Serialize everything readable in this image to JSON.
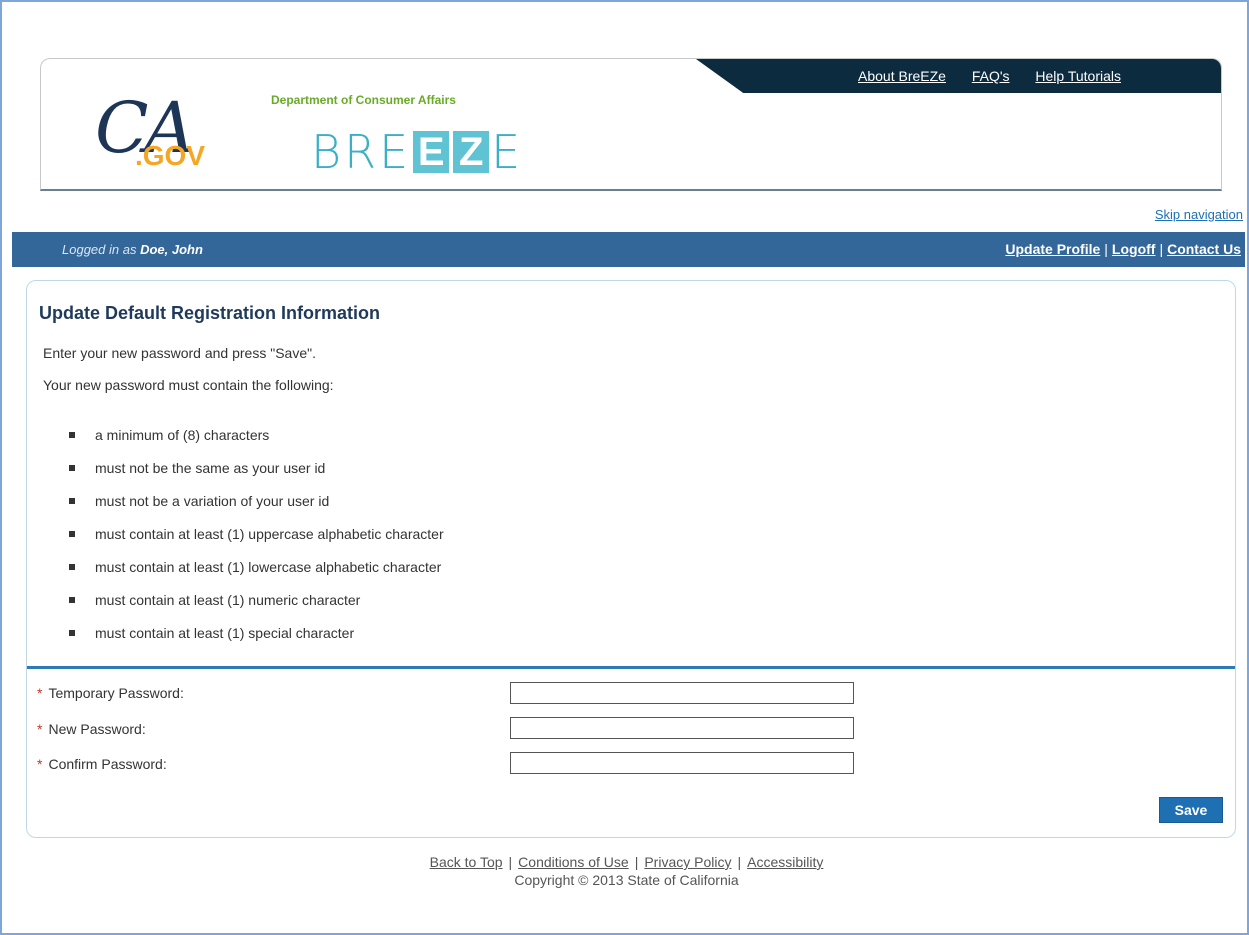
{
  "header": {
    "top_links": [
      "About BreEZe",
      "FAQ's",
      "Help Tutorials"
    ],
    "ca_logo": {
      "text_main": "CA",
      "text_suffix": ".GOV"
    },
    "dca_text": "Department of Consumer Affairs",
    "breeze_logo": {
      "pre": "BRE",
      "box1": "E",
      "box2": "Z",
      "post": "E"
    }
  },
  "skip_navigation": "Skip navigation",
  "userbar": {
    "logged_in_prefix": "Logged in as",
    "user_name": "Doe, John",
    "links": [
      "Update Profile",
      "Logoff",
      "Contact Us"
    ],
    "separator": "|"
  },
  "main": {
    "title": "Update Default Registration Information",
    "intro1": "Enter your new password and press \"Save\".",
    "intro2": "Your new password must contain the following:",
    "rules": [
      "a minimum of (8) characters",
      "must not be the same as your user id",
      "must not be a variation of your user id",
      "must contain at least (1) uppercase alphabetic character",
      "must contain at least (1) lowercase alphabetic character",
      "must contain at least (1) numeric character",
      "must contain at least (1) special character"
    ],
    "form": {
      "required_marker": "*",
      "fields": [
        {
          "label": "Temporary Password:",
          "value": ""
        },
        {
          "label": "New Password:",
          "value": ""
        },
        {
          "label": "Confirm Password:",
          "value": ""
        }
      ],
      "save_label": "Save"
    }
  },
  "footer": {
    "links": [
      "Back to Top",
      "Conditions of Use",
      "Privacy Policy",
      "Accessibility"
    ],
    "separator": "|",
    "copyright": "Copyright © 2013 State of California"
  },
  "colors": {
    "frame_border": "#7ea6d8",
    "top_nav_bg": "#0c2b3e",
    "userbar_bg": "#336699",
    "section_divider": "#2d7bb4",
    "save_button": "#1f6fb3",
    "dca_green": "#6aaa2a",
    "breeze_teal": "#3ab0c7",
    "required_red": "#c0392b"
  }
}
